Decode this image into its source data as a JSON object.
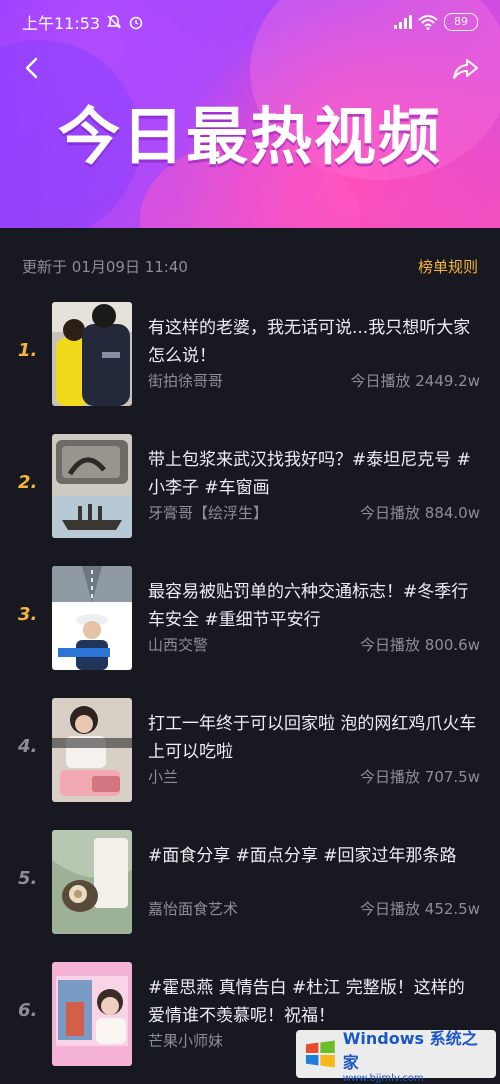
{
  "status_bar": {
    "time": "上午11:53",
    "battery": "89"
  },
  "header": {
    "title": "今日最热视频"
  },
  "info": {
    "update_time": "更新于 01月09日 11:40",
    "rules_link": "榜单规则"
  },
  "list": [
    {
      "rank": "1.",
      "title": "有这样的老婆，我无话可说...我只想听大家怎么说！",
      "author": "街拍徐哥哥",
      "plays": "今日播放 2449.2w"
    },
    {
      "rank": "2.",
      "title": "带上包浆来武汉找我好吗？#泰坦尼克号 #小李子 #车窗画",
      "author": "牙膏哥【绘浮生】",
      "plays": "今日播放 884.0w"
    },
    {
      "rank": "3.",
      "title": "最容易被贴罚单的六种交通标志！#冬季行车安全 #重细节平安行",
      "author": "山西交警",
      "plays": "今日播放 800.6w"
    },
    {
      "rank": "4.",
      "title": "打工一年终于可以回家啦 泡的网红鸡爪火车上可以吃啦",
      "author": "小兰",
      "plays": "今日播放 707.5w"
    },
    {
      "rank": "5.",
      "title": "#面食分享 #面点分享 #回家过年那条路",
      "author": "嘉怡面食艺术",
      "plays": "今日播放 452.5w"
    },
    {
      "rank": "6.",
      "title": "#霍思燕 真情告白 #杜江 完整版！这样的爱情谁不羡慕呢！祝福！",
      "author": "芒果小师妹",
      "plays": ""
    }
  ],
  "watermark": {
    "brand": "Windows",
    "brand_cn": "系统之家",
    "url": "www.bjjmlv.com"
  },
  "colors": {
    "accent": "#f2b53a",
    "background": "#181821",
    "hero_start": "#8a35ff",
    "hero_end": "#f04fc0"
  }
}
